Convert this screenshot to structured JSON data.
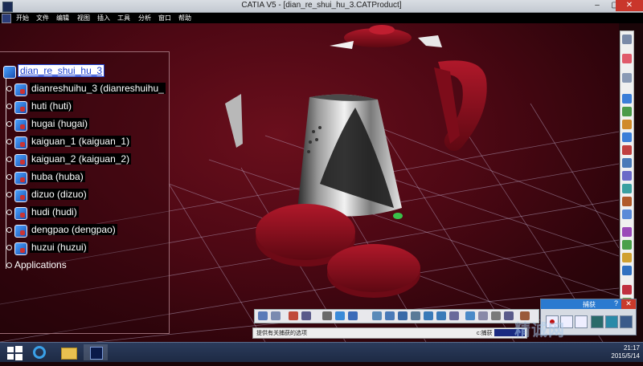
{
  "window": {
    "title": "CATIA V5 - [dian_re_shui_hu_3.CATProduct]",
    "close": "✕",
    "max": "▢",
    "min": "–"
  },
  "menu": [
    {
      "label": "开始"
    },
    {
      "label": "文件"
    },
    {
      "label": "编辑"
    },
    {
      "label": "视图"
    },
    {
      "label": "插入"
    },
    {
      "label": "工具"
    },
    {
      "label": "分析"
    },
    {
      "label": "窗口"
    },
    {
      "label": "帮助"
    }
  ],
  "tree": {
    "root": "dian_re_shui_hu_3",
    "items": [
      {
        "label": "dianreshuihu_3 (dianreshuihu_"
      },
      {
        "label": "huti (huti)"
      },
      {
        "label": "hugai (hugai)"
      },
      {
        "label": "kaiguan_1 (kaiguan_1)"
      },
      {
        "label": "kaiguan_2 (kaiguan_2)"
      },
      {
        "label": "huba (huba)"
      },
      {
        "label": "dizuo (dizuo)"
      },
      {
        "label": "hudi (hudi)"
      },
      {
        "label": "dengpao (dengpao)"
      },
      {
        "label": "huzui (huzui)"
      }
    ],
    "applications": "Applications"
  },
  "status": {
    "message": "提供有关捕获的选项",
    "command_label": "c:捕获"
  },
  "capture_panel": {
    "title": "捕获",
    "help": "?",
    "close": "✕"
  },
  "clock": {
    "time": "21:17",
    "date": "2015/5/14"
  },
  "watermark": "精诚网",
  "colors": {
    "viewport": "#4e0814",
    "kettle_red": "#8f1020",
    "selection": "#1a3fd0"
  }
}
